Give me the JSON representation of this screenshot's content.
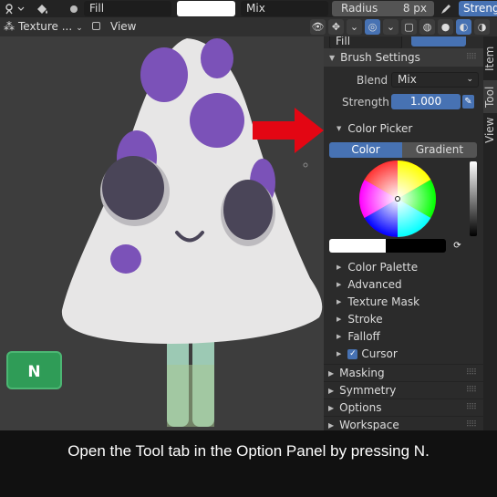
{
  "header": {
    "fill_label": "Fill",
    "blend_mode": "Mix",
    "radius_label": "Radius",
    "radius_value": "8 px",
    "strength_cut": "Streng"
  },
  "subheader": {
    "texture_dropdown": "Texture ...",
    "view_menu": "View",
    "fill_cut": "Fill"
  },
  "overlay": {
    "n_key": "N"
  },
  "panel": {
    "brush_settings": "Brush Settings",
    "blend_label": "Blend",
    "blend_value": "Mix",
    "strength_label": "Strength",
    "strength_value": "1.000",
    "color_picker": "Color Picker",
    "color_tab": "Color",
    "gradient_tab": "Gradient",
    "subpanels": [
      "Color Palette",
      "Advanced",
      "Texture Mask",
      "Stroke",
      "Falloff"
    ],
    "cursor_label": "Cursor",
    "sections": [
      "Masking",
      "Symmetry",
      "Options",
      "Workspace"
    ]
  },
  "tabs": [
    "Item",
    "Tool",
    "View"
  ],
  "caption": "Open the Tool tab in the Option Panel by pressing N.",
  "colors": {
    "accent_blue": "#4772b3",
    "n_key_green": "#2f9c57",
    "arrow_red": "#e30613",
    "character_body": "#e7e6e6",
    "spots_purple": "#7b52b8"
  }
}
